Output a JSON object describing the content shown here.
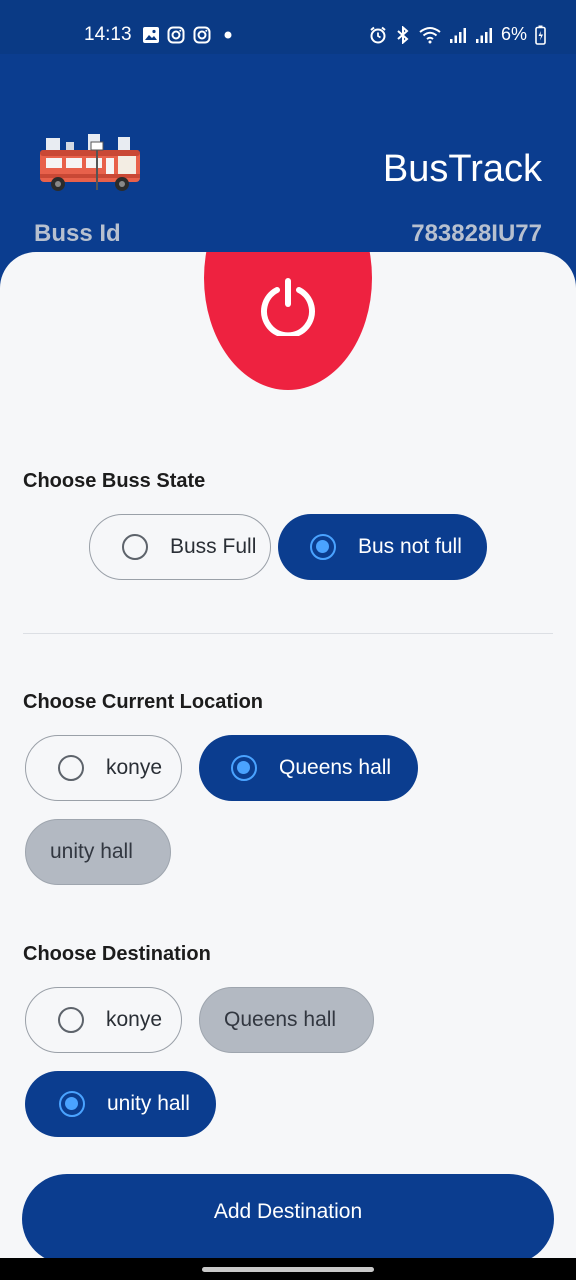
{
  "status_bar": {
    "time": "14:13",
    "battery": "6%",
    "icons": [
      "gallery-icon",
      "instagram-icon",
      "instagram-icon",
      "dot-icon",
      "alarm-icon",
      "bluetooth-icon",
      "wifi-icon",
      "signal-icon",
      "signal-icon",
      "battery-charging-icon"
    ]
  },
  "header": {
    "logo_icon": "bus-logo-icon",
    "title": "BusTrack",
    "bus_id_label": "Buss Id",
    "bus_id_value": "783828IU77"
  },
  "power_button": {
    "icon": "power-icon",
    "color": "#ee2240"
  },
  "bus_state": {
    "title": "Choose Buss State",
    "options": [
      {
        "label": "Buss Full",
        "selected": false
      },
      {
        "label": "Bus not full",
        "selected": true
      }
    ]
  },
  "current_location": {
    "title": "Choose Current Location",
    "options": [
      {
        "label": "konye",
        "selected": false
      },
      {
        "label": "Queens hall",
        "selected": true
      },
      {
        "label": "unity hall",
        "selected": false,
        "disabled": true
      }
    ]
  },
  "destination": {
    "title": "Choose Destination",
    "options": [
      {
        "label": "konye",
        "selected": false
      },
      {
        "label": "Queens hall",
        "selected": false,
        "disabled": true
      },
      {
        "label": "unity hall",
        "selected": true
      }
    ]
  },
  "add_button": {
    "label": "Add Destination"
  },
  "colors": {
    "primary": "#0b3d8f",
    "accent": "#4aa3ff",
    "danger": "#ee2240",
    "background": "#f6f7f9"
  }
}
